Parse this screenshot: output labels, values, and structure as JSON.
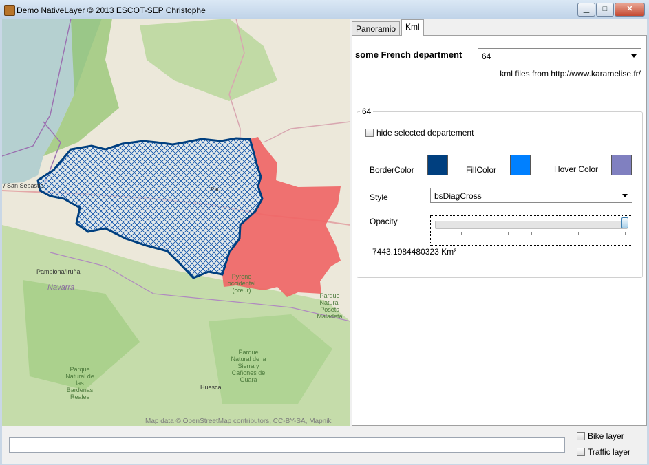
{
  "window": {
    "title": "Demo NativeLayer © 2013 ESCOT-SEP Christophe",
    "minimize_label": "▁",
    "maximize_label": "□",
    "close_label": "✕"
  },
  "map": {
    "attribution": "Map data © OpenStreetMap contributors, CC-BY-SA, Mapnik",
    "labels": {
      "san_sebastian": "/ San Sebastia",
      "pau": "Pau",
      "pamplona": "Pamplona/Iruña",
      "navarra": "Navarra",
      "pyrenees": "Pyrene occidental (cœur)",
      "posets": "Parque Natural Posets Maladeta",
      "bardenas": "Parque Natural de las Bardenas Reales",
      "guara": "Parque Natural de la Sierra y Cañones de Guara",
      "huesca": "Huesca"
    },
    "colors": {
      "selected_border": "#003f7f",
      "selected_hatch": "#0a4fa8",
      "hover_fill": "#ef6464"
    }
  },
  "tabs": [
    {
      "label": "Panoramio",
      "active": false
    },
    {
      "label": "Kml",
      "active": true
    }
  ],
  "kml": {
    "department_label": "some French department",
    "department_value": "64",
    "kml_source_note": "kml files from http://www.karamelise.fr/",
    "group_title": "64",
    "hide_checkbox_label": "hide selected departement",
    "border_color_label": "BorderColor",
    "fill_color_label": "FillColor",
    "hover_color_label": "Hover Color",
    "border_color": "#003f7f",
    "fill_color": "#0080ff",
    "hover_color": "#8080c0",
    "style_label": "Style",
    "style_value": "bsDiagCross",
    "opacity_label": "Opacity",
    "opacity_value": 1.0,
    "area_text": "7443.1984480323 Km²"
  },
  "bottom": {
    "bike_layer_label": "Bike layer",
    "traffic_layer_label": "Traffic layer",
    "status_value": ""
  }
}
